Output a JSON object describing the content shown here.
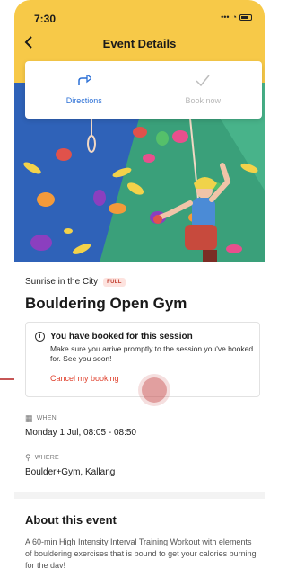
{
  "status_bar": {
    "time": "7:30"
  },
  "header": {
    "title": "Event Details",
    "back_icon": "chevron-left-icon"
  },
  "actions": [
    {
      "label": "Directions",
      "icon": "directions-icon"
    },
    {
      "label": "Book now",
      "icon": "check-icon"
    }
  ],
  "event": {
    "organizer": "Sunrise in the City",
    "badge": "FULL",
    "name": "Bouldering Open Gym"
  },
  "booking_notice": {
    "title": "You have booked for this session",
    "description": "Make sure you arrive promptly to the session you've booked for. See you soon!",
    "cancel_label": "Cancel my booking"
  },
  "when": {
    "label": "WHEN",
    "value": "Monday 1 Jul, 08:05 - 08:50"
  },
  "where": {
    "label": "WHERE",
    "value": "Boulder+Gym, Kallang"
  },
  "about": {
    "title": "About this event",
    "text": "A 60-min High Intensity Interval Training Workout with elements of bouldering exercises that is bound to get your calories burning for the day!"
  },
  "colors": {
    "header_bg": "#f7c948",
    "primary_blue": "#2a6fd6",
    "cancel_red": "#e0412d",
    "annotation_red": "#b41e1e"
  }
}
